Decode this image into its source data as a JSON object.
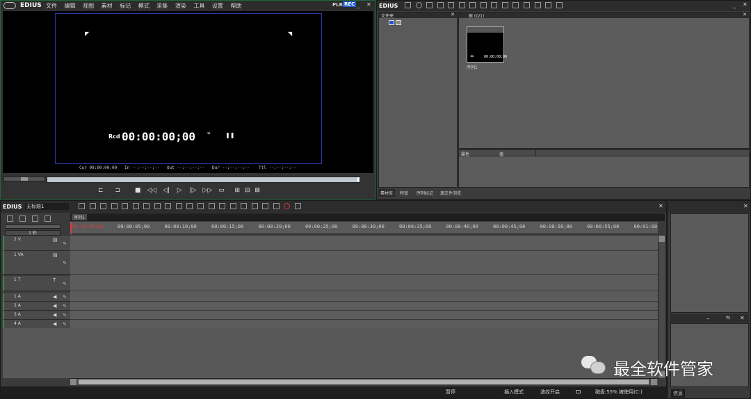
{
  "player": {
    "logo": "EDIUS",
    "menu": [
      "文件",
      "编辑",
      "视图",
      "素材",
      "标记",
      "模式",
      "采集",
      "渲染",
      "工具",
      "设置",
      "帮助"
    ],
    "mode_plr": "PLR",
    "mode_rec": "REC",
    "rcd_label": "Rcd",
    "timecode": "00:00:00;00",
    "timecode_flag": "*",
    "cur_label": "Cur 00:00:00;00",
    "in_label": "In --:--:--:--",
    "out_label": "Out --:--:--:--",
    "dur_label": "Dur --:--:--:--",
    "ttl_label": "Ttl --:--:--:--"
  },
  "bin": {
    "logo": "EDIUS",
    "folder_header": "文件夹",
    "bin_header": "根 (0/1)",
    "clip_name": "序列1",
    "clip_tc": "00:00:00;00",
    "prop_header": "属性",
    "value_header": "值",
    "tabs": [
      "素材库",
      "特效",
      "序列标记",
      "源文件浏览"
    ]
  },
  "timeline": {
    "logo": "EDIUS",
    "project_name": "无标题1",
    "sequence_tab": "序列1",
    "scale_label": "1 秒",
    "ruler_start": "00:00:00;00",
    "ruler": [
      "00:00:05;00",
      "00:00:10;00",
      "00:00:15;00",
      "00:00:20;00",
      "00:00:25;00",
      "00:00:30;00",
      "00:00:35;00",
      "00:00:40;00",
      "00:00:45;00",
      "00:00:50;00",
      "00:00:55;00",
      "00:01:00"
    ],
    "tracks": [
      {
        "name": "2 V",
        "kind": "video"
      },
      {
        "name": "1 VA",
        "kind": "videoaudio"
      },
      {
        "name": "1 T",
        "kind": "title"
      },
      {
        "name": "1 A",
        "kind": "audio"
      },
      {
        "name": "2 A",
        "kind": "audio"
      },
      {
        "name": "3 A",
        "kind": "audio"
      },
      {
        "name": "4 A",
        "kind": "audio"
      }
    ]
  },
  "right_panel": {
    "info_tab": "信息"
  },
  "status": {
    "paused": "暂停",
    "insert_mode": "插入模式",
    "ripple": "波纹开启",
    "disk": "磁盘:55% 被使用(C:)"
  },
  "watermark": "最全软件管家",
  "colors": {
    "accent_blue": "#2a3aa8",
    "rec_blue": "#1f5fd0",
    "track_border_green": "#3a8a4a",
    "playhead_red": "#d04040"
  }
}
